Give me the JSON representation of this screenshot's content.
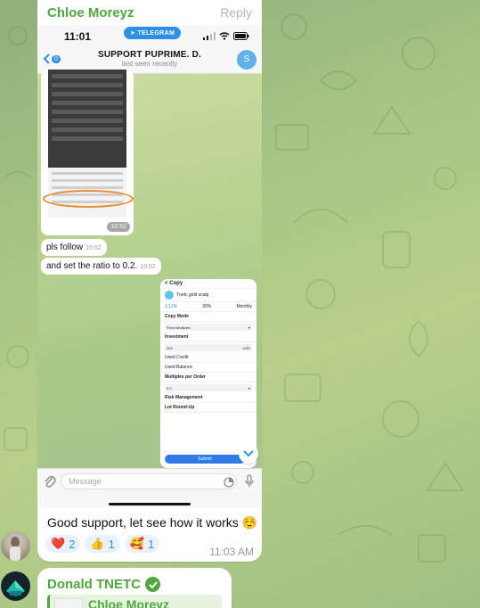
{
  "message1": {
    "sender": "Chloe Moreyz",
    "reply_label": "Reply",
    "caption": "Good support, let see how it works ☺️",
    "time": "11:03 AM",
    "reactions": [
      {
        "emoji": "❤️",
        "count": "2"
      },
      {
        "emoji": "👍",
        "count": "1"
      },
      {
        "emoji": "🥰",
        "count": "1"
      }
    ]
  },
  "screenshot": {
    "status_time": "11:01",
    "telegram_pill": "TELEGRAM",
    "back_count": "0",
    "chat_title": "SUPPORT PUPRIME. D.",
    "chat_subtitle": "last seen recently",
    "avatar_letter": "S",
    "image1_time": "10:52",
    "msg_follow": "pls follow",
    "msg_follow_time": "10:52",
    "msg_ratio": "and set the ratio to 0.2.",
    "msg_ratio_time": "10:52",
    "copy_form": {
      "back_label": "< Copy",
      "provider": "Tnetc gold scalp",
      "return_value": "3.12%",
      "profit_sharing": "20%",
      "settlement": "Monthly",
      "copy_mode_label": "Copy Mode",
      "copy_mode_value": "Fixed Multiples",
      "investment_label": "Investment",
      "investment_value": "269",
      "currency": "USD",
      "used_credit_label": "Used Credit",
      "used_balance_label": "Used Balance",
      "multiples_label": "Multiples per Order",
      "multiples_value": "0.2",
      "risk_label": "Risk Management",
      "lot_label": "Lot Round-Up",
      "submit_label": "Submit"
    },
    "input_placeholder": "Message"
  },
  "message2": {
    "sender": "Donald TNETC",
    "quoted_sender": "Chloe Moreyz"
  }
}
